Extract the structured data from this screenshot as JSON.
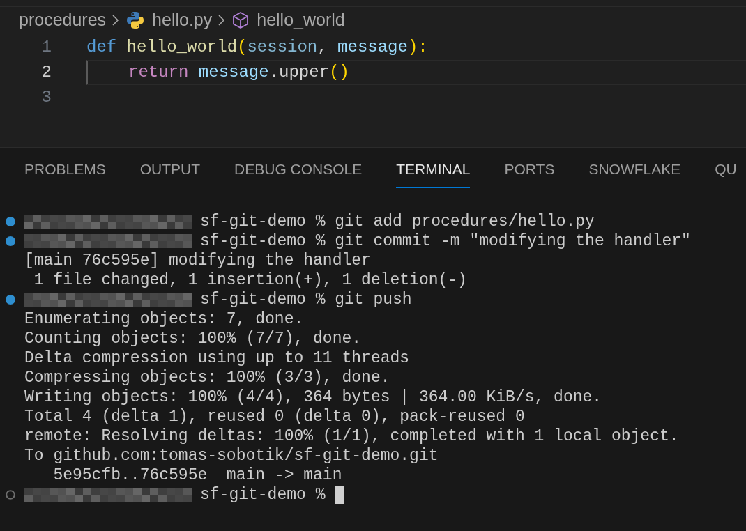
{
  "breadcrumb": [
    {
      "label": "procedures",
      "kind": "folder"
    },
    {
      "label": "hello.py",
      "kind": "python"
    },
    {
      "label": "hello_world",
      "kind": "method"
    }
  ],
  "editor": {
    "lines": [
      {
        "number": "1",
        "current": false,
        "tokens": [
          {
            "text": "def ",
            "kind": "keyword"
          },
          {
            "text": "hello_world",
            "kind": "function"
          },
          {
            "text": "(",
            "kind": "bracket"
          },
          {
            "text": "session",
            "kind": "param"
          },
          {
            "text": ", ",
            "kind": "plain"
          },
          {
            "text": "message",
            "kind": "variable"
          },
          {
            "text": "):",
            "kind": "bracket"
          }
        ]
      },
      {
        "number": "2",
        "current": true,
        "indented": true,
        "tokens": [
          {
            "text": "return ",
            "kind": "control"
          },
          {
            "text": "message",
            "kind": "variable"
          },
          {
            "text": ".upper",
            "kind": "plain"
          },
          {
            "text": "()",
            "kind": "bracket"
          }
        ]
      },
      {
        "number": "3",
        "current": false
      }
    ]
  },
  "panel_tabs": [
    {
      "label": "PROBLEMS",
      "selected": false
    },
    {
      "label": "OUTPUT",
      "selected": false
    },
    {
      "label": "DEBUG CONSOLE",
      "selected": false
    },
    {
      "label": "TERMINAL",
      "selected": true
    },
    {
      "label": "PORTS",
      "selected": false
    },
    {
      "label": "SNOWFLAKE",
      "selected": false
    },
    {
      "label": "QU",
      "selected": false
    }
  ],
  "terminal": [
    {
      "kind": "command",
      "finished": true,
      "text": "sf-git-demo % git add procedures/hello.py"
    },
    {
      "kind": "command",
      "finished": true,
      "text": "sf-git-demo % git commit -m \"modifying the handler\""
    },
    {
      "kind": "output",
      "text": "[main 76c595e] modifying the handler"
    },
    {
      "kind": "output",
      "text": " 1 file changed, 1 insertion(+), 1 deletion(-)"
    },
    {
      "kind": "command",
      "finished": true,
      "text": "sf-git-demo % git push"
    },
    {
      "kind": "output",
      "text": "Enumerating objects: 7, done."
    },
    {
      "kind": "output",
      "text": "Counting objects: 100% (7/7), done."
    },
    {
      "kind": "output",
      "text": "Delta compression using up to 11 threads"
    },
    {
      "kind": "output",
      "text": "Compressing objects: 100% (3/3), done."
    },
    {
      "kind": "output",
      "text": "Writing objects: 100% (4/4), 364 bytes | 364.00 KiB/s, done."
    },
    {
      "kind": "output",
      "text": "Total 4 (delta 1), reused 0 (delta 0), pack-reused 0"
    },
    {
      "kind": "output",
      "text": "remote: Resolving deltas: 100% (1/1), completed with 1 local object."
    },
    {
      "kind": "output",
      "text": "To github.com:tomas-sobotik/sf-git-demo.git"
    },
    {
      "kind": "output",
      "text": "   5e95cfb..76c595e  main -> main"
    },
    {
      "kind": "command",
      "finished": false,
      "text": "sf-git-demo %",
      "cursor": true
    }
  ]
}
